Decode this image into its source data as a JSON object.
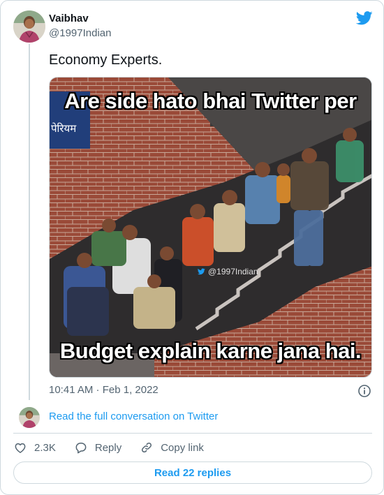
{
  "tweet": {
    "author_name": "Vaibhav",
    "author_handle": "@1997Indian",
    "text": "Economy Experts.",
    "timestamp": "10:41 AM · Feb 1, 2022"
  },
  "media": {
    "meme_top_text": "Are side hato bhai Twitter per",
    "meme_bottom_text": "Budget explain karne jana hai.",
    "watermark": "@1997Indian",
    "sign_text": "पेरियम"
  },
  "conversation_link": "Read the full conversation on Twitter",
  "actions": {
    "likes_count": "2.3K",
    "reply_label": "Reply",
    "copy_link_label": "Copy link"
  },
  "replies_button": "Read 22 replies",
  "colors": {
    "twitter_blue": "#1d9bf0",
    "text_primary": "#0f1419",
    "text_secondary": "#536471",
    "border": "#cfd9de"
  },
  "icons": [
    "twitter-bird-icon",
    "info-icon",
    "heart-icon",
    "reply-bubble-icon",
    "link-icon"
  ]
}
